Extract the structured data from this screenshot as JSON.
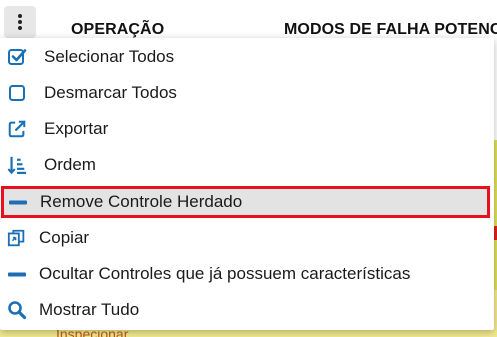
{
  "colors": {
    "accent": "#1a6fb5",
    "highlight_border": "#e8101c",
    "highlight_background": "#e3e3e3",
    "row_yellow": "#dfe05a",
    "row_light_yellow": "#f3ea8f"
  },
  "table": {
    "headers": {
      "operacao": "OPERAÇÃO",
      "modos": "MODOS DE FALHA POTENC"
    },
    "peek_text": "Inspecionar"
  },
  "menu": {
    "items": [
      {
        "label": "Selecionar Todos",
        "icon": "checkbox-checked-icon"
      },
      {
        "label": "Desmarcar Todos",
        "icon": "checkbox-empty-icon"
      },
      {
        "label": "Exportar",
        "icon": "external-link-icon"
      },
      {
        "label": "Ordem",
        "icon": "sort-numeric-icon"
      },
      {
        "label": "Remove Controle Herdado",
        "icon": "minus-icon",
        "highlighted": true
      },
      {
        "label": "Copiar",
        "icon": "copy-icon"
      },
      {
        "label": "Ocultar Controles que já possuem características",
        "icon": "minus-icon"
      },
      {
        "label": "Mostrar Tudo",
        "icon": "search-icon"
      }
    ]
  }
}
